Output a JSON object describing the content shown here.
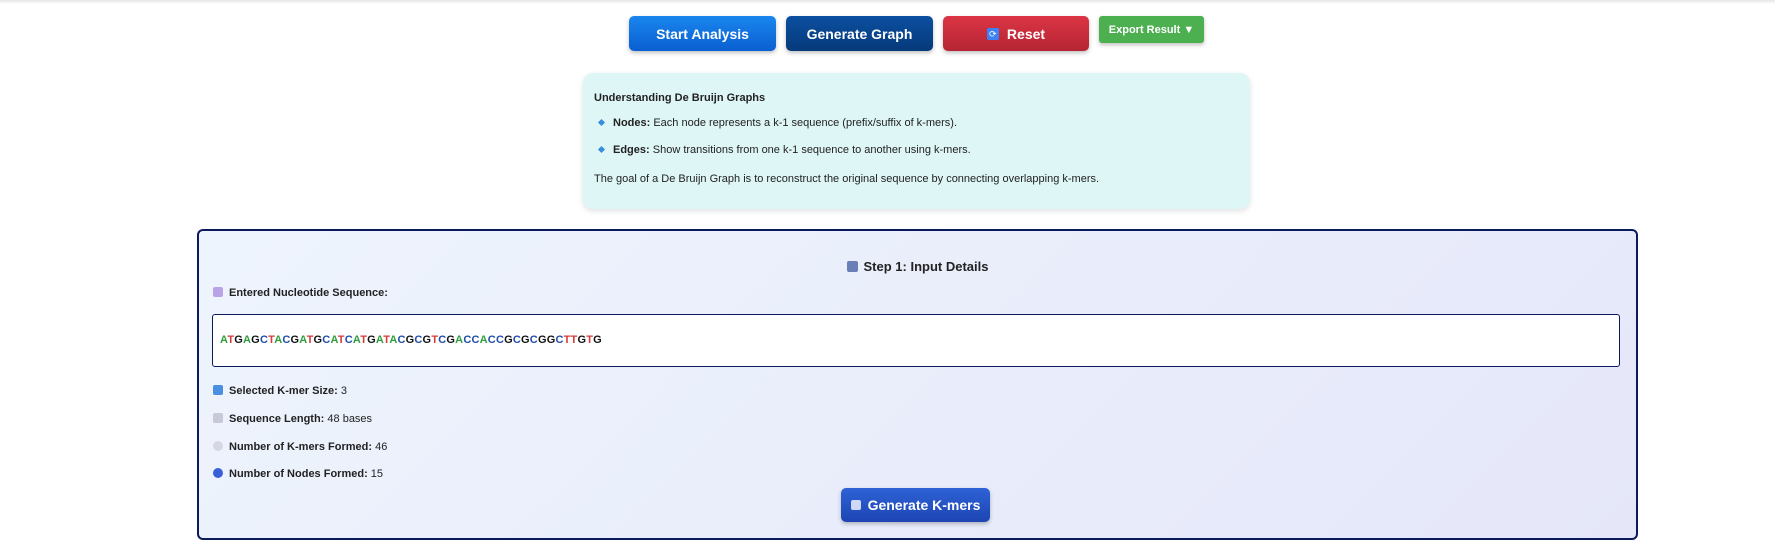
{
  "toolbar": {
    "start_label": "Start Analysis",
    "graph_label": "Generate Graph",
    "reset_label": "Reset",
    "export_label": "Export Result ▼"
  },
  "info": {
    "title": "Understanding De Bruijn Graphs",
    "nodes_term": "Nodes:",
    "nodes_text": "Each node represents a k-1 sequence (prefix/suffix of k-mers).",
    "edges_term": "Edges:",
    "edges_text": "Show transitions from one k-1 sequence to another using k-mers.",
    "goal": "The goal of a De Bruijn Graph is to reconstruct the original sequence by connecting overlapping k-mers."
  },
  "step1": {
    "title": "Step 1: Input Details",
    "sequence_label": "Entered Nucleotide Sequence:",
    "sequence": "ATGAGCTACGATGCATCATGATACGCGTCGACCACCGCGCGGCTTGTG",
    "kmer_label": "Selected K-mer Size:",
    "kmer_value": "3",
    "length_label": "Sequence Length:",
    "length_value": "48 bases",
    "kmers_formed_label": "Number of K-mers Formed:",
    "kmers_formed_value": "46",
    "nodes_formed_label": "Number of Nodes Formed:",
    "nodes_formed_value": "15",
    "generate_label": "Generate K-mers"
  },
  "colors": {
    "A": "#2e9d3c",
    "T": "#d63a3a",
    "G": "#111111",
    "C": "#1f4ea8",
    "panel_border": "#0b1a5a",
    "info_bg": "#dff6f6",
    "export_green": "#4caf50"
  }
}
